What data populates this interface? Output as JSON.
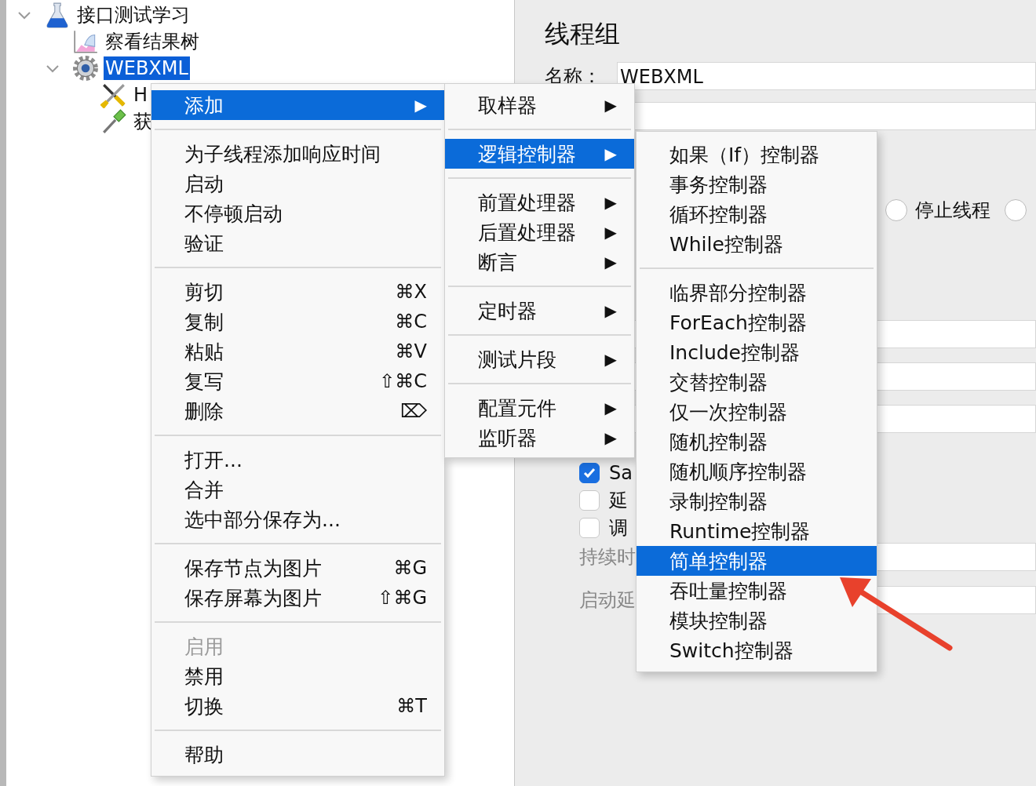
{
  "tree": [
    {
      "label": "接口测试学习",
      "kind": "flask",
      "expanded": true,
      "selected": false,
      "children": [
        {
          "label": "察看结果树",
          "kind": "chart",
          "selected": false
        },
        {
          "label": "WEBXML",
          "kind": "gear",
          "expanded": true,
          "selected": true,
          "children": [
            {
              "label": "H",
              "kind": "tools",
              "selected": false
            },
            {
              "label": "获",
              "kind": "dropper",
              "selected": false
            }
          ]
        }
      ]
    }
  ],
  "panel": {
    "title": "线程组",
    "name_label": "名称：",
    "name_value": "WEBXML",
    "radios": [
      {
        "label": "停止线程",
        "selected": false
      },
      {
        "selected": false
      }
    ],
    "checkboxes": [
      {
        "label": "Sa",
        "checked": true
      },
      {
        "label": "延",
        "checked": false
      },
      {
        "label": "调",
        "checked": false
      }
    ],
    "field_labels": [
      "持续时",
      "启动延"
    ]
  },
  "context_menu": {
    "groups": [
      [
        {
          "label": "添加",
          "arrow": "▶",
          "selected": true,
          "disabled": false
        }
      ],
      [
        {
          "label": "为子线程添加响应时间",
          "selected": false,
          "disabled": false
        },
        {
          "label": "启动",
          "selected": false,
          "disabled": false
        },
        {
          "label": "不停顿启动",
          "selected": false,
          "disabled": false
        },
        {
          "label": "验证",
          "selected": false,
          "disabled": false
        }
      ],
      [
        {
          "label": "剪切",
          "shortcut": "⌘X",
          "selected": false,
          "disabled": false
        },
        {
          "label": "复制",
          "shortcut": "⌘C",
          "selected": false,
          "disabled": false
        },
        {
          "label": "粘贴",
          "shortcut": "⌘V",
          "selected": false,
          "disabled": false
        },
        {
          "label": "复写",
          "shortcut": "⇧⌘C",
          "selected": false,
          "disabled": false
        },
        {
          "label": "删除",
          "shortcut": "⌦",
          "selected": false,
          "disabled": false
        }
      ],
      [
        {
          "label": "打开...",
          "selected": false,
          "disabled": false
        },
        {
          "label": "合并",
          "selected": false,
          "disabled": false
        },
        {
          "label": "选中部分保存为...",
          "selected": false,
          "disabled": false
        }
      ],
      [
        {
          "label": "保存节点为图片",
          "shortcut": "⌘G",
          "selected": false,
          "disabled": false
        },
        {
          "label": "保存屏幕为图片",
          "shortcut": "⇧⌘G",
          "selected": false,
          "disabled": false
        }
      ],
      [
        {
          "label": "启用",
          "selected": false,
          "disabled": true
        },
        {
          "label": "禁用",
          "selected": false,
          "disabled": false
        },
        {
          "label": "切换",
          "shortcut": "⌘T",
          "selected": false,
          "disabled": false
        }
      ],
      [
        {
          "label": "帮助",
          "selected": false,
          "disabled": false
        }
      ]
    ]
  },
  "add_submenu": {
    "groups": [
      [
        {
          "label": "取样器",
          "arrow": "▶",
          "selected": false
        }
      ],
      [
        {
          "label": "逻辑控制器",
          "arrow": "▶",
          "selected": true
        }
      ],
      [
        {
          "label": "前置处理器",
          "arrow": "▶",
          "selected": false
        },
        {
          "label": "后置处理器",
          "arrow": "▶",
          "selected": false
        },
        {
          "label": "断言",
          "arrow": "▶",
          "selected": false
        }
      ],
      [
        {
          "label": "定时器",
          "arrow": "▶",
          "selected": false
        }
      ],
      [
        {
          "label": "测试片段",
          "arrow": "▶",
          "selected": false
        }
      ],
      [
        {
          "label": "配置元件",
          "arrow": "▶",
          "selected": false
        },
        {
          "label": "监听器",
          "arrow": "▶",
          "selected": false
        }
      ]
    ]
  },
  "controller_submenu": {
    "groups": [
      [
        {
          "label": "如果（If）控制器",
          "selected": false
        },
        {
          "label": "事务控制器",
          "selected": false
        },
        {
          "label": "循环控制器",
          "selected": false
        },
        {
          "label": "While控制器",
          "selected": false
        }
      ],
      [
        {
          "label": "临界部分控制器",
          "selected": false
        },
        {
          "label": "ForEach控制器",
          "selected": false
        },
        {
          "label": "Include控制器",
          "selected": false
        },
        {
          "label": "交替控制器",
          "selected": false
        },
        {
          "label": "仅一次控制器",
          "selected": false
        },
        {
          "label": "随机控制器",
          "selected": false
        },
        {
          "label": "随机顺序控制器",
          "selected": false
        },
        {
          "label": "录制控制器",
          "selected": false
        },
        {
          "label": "Runtime控制器",
          "selected": false
        },
        {
          "label": "简单控制器",
          "selected": true
        },
        {
          "label": "吞吐量控制器",
          "selected": false
        },
        {
          "label": "模块控制器",
          "selected": false
        },
        {
          "label": "Switch控制器",
          "selected": false
        }
      ]
    ]
  }
}
